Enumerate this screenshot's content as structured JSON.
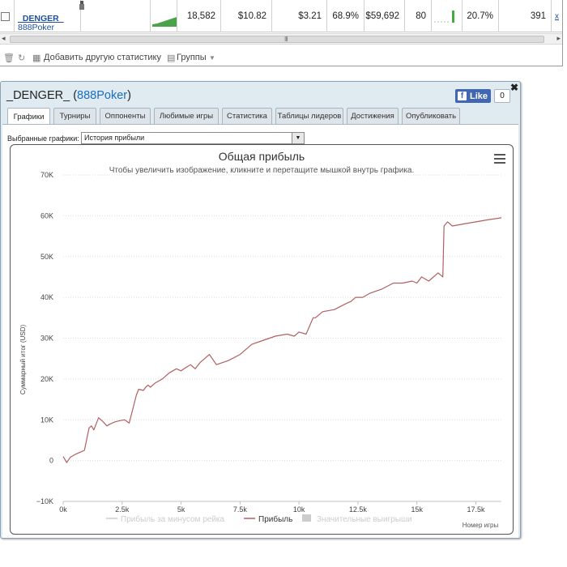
{
  "grid_row": {
    "player_name": "_DENGER_",
    "player_site": "888Poker",
    "hands": "18,582",
    "col2": "$10.82",
    "col3": "$3.21",
    "col4": "68.9%",
    "col5": "$59,692",
    "col6": "80",
    "col7": "20.7%",
    "col8": "391"
  },
  "grid_toolbar": {
    "add_stats": "Добавить другую статистику",
    "groups": "Группы"
  },
  "window": {
    "title_name": "_DENGER_",
    "title_site": "888Poker",
    "like_label": "Like",
    "like_count": "0",
    "tabs": [
      "Графики",
      "Турниры",
      "Оппоненты",
      "Любимые игры",
      "Статистика",
      "Таблицы лидеров",
      "Достижения",
      "Опубликовать"
    ],
    "active_tab": "Графики",
    "selected_graphs_label": "Выбранные графики:",
    "selected_graph_value": "История прибыли"
  },
  "colors": {
    "series_line": "#b26060",
    "legend_muted": "#cccccc",
    "accent_link": "#1d6fb8"
  },
  "chart_data": {
    "type": "line",
    "title": "Общая прибыль",
    "subtitle": "Чтобы увеличить изображение, кликните и перетащите мышкой внутрь графика.",
    "ylabel": "Суммарный итог (USD)",
    "xlabel": "Номер игры",
    "ylim": [
      -10000,
      70000
    ],
    "xlim": [
      0,
      18582
    ],
    "y_ticks": [
      "−10K",
      "0",
      "10K",
      "20K",
      "30K",
      "40K",
      "50K",
      "60K",
      "70K"
    ],
    "x_ticks": [
      "0k",
      "2.5k",
      "5k",
      "7.5k",
      "10k",
      "12.5k",
      "15k",
      "17.5k"
    ],
    "grid": true,
    "legend": [
      {
        "name": "Прибыль за минусом рейка",
        "visible": false
      },
      {
        "name": "Прибыль",
        "visible": true
      },
      {
        "name": "Значительные выигрыши",
        "visible": false
      }
    ],
    "series": [
      {
        "name": "Прибыль",
        "x": [
          0,
          150,
          300,
          500,
          700,
          900,
          1100,
          1200,
          1300,
          1500,
          1700,
          1850,
          2000,
          2200,
          2400,
          2600,
          2800,
          3100,
          3200,
          3400,
          3500,
          3600,
          3700,
          3900,
          4200,
          4500,
          4800,
          5000,
          5200,
          5400,
          5600,
          5800,
          6000,
          6200,
          6500,
          7000,
          7500,
          8000,
          8500,
          9000,
          9500,
          9800,
          10000,
          10300,
          10600,
          10700,
          11000,
          11500,
          12000,
          12200,
          12400,
          12700,
          13000,
          13500,
          14000,
          14400,
          14800,
          15000,
          15200,
          15500,
          15900,
          16100,
          16150,
          16300,
          16500,
          17000,
          17500,
          18000,
          18582
        ],
        "y": [
          1000,
          -500,
          800,
          1500,
          2000,
          2500,
          8000,
          8500,
          7500,
          10500,
          9500,
          8500,
          9000,
          9500,
          9800,
          10000,
          9200,
          16000,
          17500,
          17200,
          18000,
          18500,
          18000,
          19000,
          20000,
          21500,
          22500,
          22000,
          22800,
          23500,
          22500,
          24000,
          25000,
          26000,
          23500,
          24500,
          26000,
          28500,
          29500,
          30500,
          31000,
          30500,
          31500,
          31000,
          35000,
          35000,
          36500,
          37000,
          38500,
          39000,
          40000,
          40000,
          41000,
          42000,
          43500,
          43500,
          44000,
          43500,
          45000,
          44000,
          46000,
          45000,
          57500,
          58500,
          57500,
          58000,
          58500,
          59000,
          59500
        ]
      }
    ]
  }
}
